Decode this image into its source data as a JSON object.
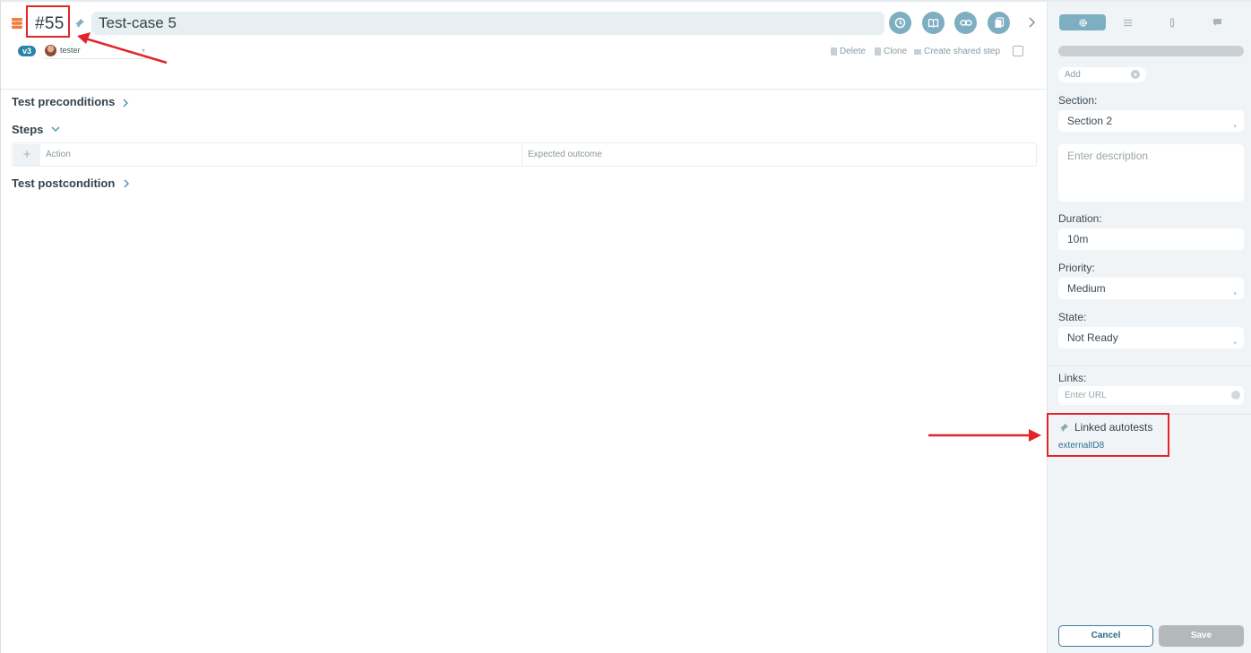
{
  "header": {
    "case_id": "#55",
    "title_value": "Test-case 5",
    "version_badge": "v3",
    "user_name": "tester",
    "actions": {
      "delete": "Delete",
      "clone": "Clone",
      "create_shared_step": "Create shared step"
    },
    "icon_buttons": [
      "history-icon",
      "book-icon",
      "link-icon",
      "copy-icon"
    ]
  },
  "main": {
    "sections": {
      "preconditions": "Test preconditions",
      "steps": "Steps",
      "postcondition": "Test postcondition"
    },
    "steps_table": {
      "add": "+",
      "col_action": "Action",
      "col_expected": "Expected outcome"
    }
  },
  "sidebar": {
    "tabs": [
      "settings-icon",
      "list-icon",
      "attachment-icon",
      "comment-icon"
    ],
    "tag_add_placeholder": "Add",
    "section_label": "Section:",
    "section_value": "Section 2",
    "description_placeholder": "Enter description",
    "duration_label": "Duration:",
    "duration_value": "10m",
    "priority_label": "Priority:",
    "priority_value": "Medium",
    "state_label": "State:",
    "state_value": "Not Ready",
    "links_label": "Links:",
    "url_placeholder": "Enter URL",
    "linked_autotests_label": "Linked autotests",
    "linked_autotest_id": "externalID8",
    "cancel_label": "Cancel",
    "save_label": "Save"
  },
  "colors": {
    "accent": "#7eaec1",
    "badge": "#2a84a7",
    "annotation": "#e0262b",
    "stack_icon": "#f07b3f"
  }
}
